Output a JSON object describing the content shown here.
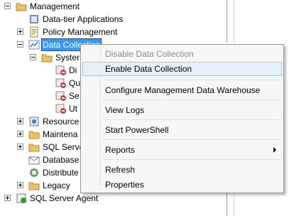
{
  "tree": {
    "management": "Management",
    "data_tier": "Data-tier Applications",
    "policy": "Policy Management",
    "data_collection": "Data Collection",
    "system": "System",
    "child_di": "Di",
    "child_qu": "Qu",
    "child_se": "Se",
    "child_ut": "Ut",
    "resource": "Resource",
    "maintenance": "Maintena",
    "sql_server": "SQL Serve",
    "database": "Database",
    "distributed": "Distribute",
    "legacy": "Legacy",
    "sql_agent": "SQL Server Agent"
  },
  "context_menu": {
    "disable": "Disable Data Collection",
    "enable": "Enable Data Collection",
    "configure": "Configure Management Data Warehouse",
    "view_logs": "View Logs",
    "powershell": "Start PowerShell",
    "reports": "Reports",
    "refresh": "Refresh",
    "properties": "Properties"
  }
}
